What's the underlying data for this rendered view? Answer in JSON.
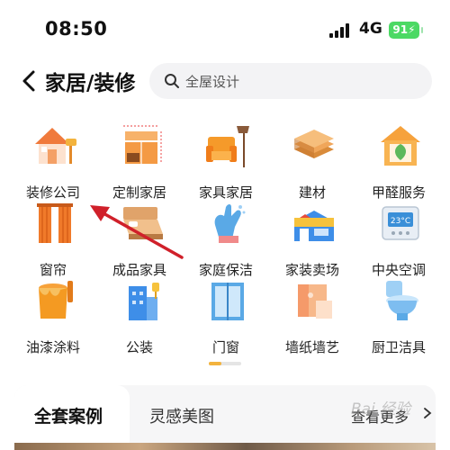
{
  "status_bar": {
    "time": "08:50",
    "network": "4G",
    "battery": "91"
  },
  "header": {
    "title": "家居/装修",
    "search_placeholder": "全屋设计"
  },
  "categories": [
    {
      "label": "装修公司",
      "icon": "house-icon"
    },
    {
      "label": "定制家居",
      "icon": "cabinet-icon"
    },
    {
      "label": "家具家居",
      "icon": "armchair-icon"
    },
    {
      "label": "建材",
      "icon": "wood-planks-icon"
    },
    {
      "label": "甲醛服务",
      "icon": "eco-house-icon"
    },
    {
      "label": "窗帘",
      "icon": "curtain-icon"
    },
    {
      "label": "成品家具",
      "icon": "bed-icon"
    },
    {
      "label": "家庭保洁",
      "icon": "cleaning-glove-icon"
    },
    {
      "label": "家装卖场",
      "icon": "store-icon"
    },
    {
      "label": "中央空调",
      "icon": "thermostat-icon"
    },
    {
      "label": "油漆涂料",
      "icon": "paint-bucket-icon"
    },
    {
      "label": "公装",
      "icon": "building-icon"
    },
    {
      "label": "门窗",
      "icon": "window-icon"
    },
    {
      "label": "墙纸墙艺",
      "icon": "wallpaper-roll-icon"
    },
    {
      "label": "厨卫洁具",
      "icon": "toilet-icon"
    }
  ],
  "tabs": {
    "active": "全套案例",
    "second": "灵感美图",
    "more": "查看更多"
  },
  "watermark": "Bai 经验",
  "colors": {
    "accent": "#f3a33a",
    "battery": "#4cd964",
    "arrow": "#d0202a"
  }
}
